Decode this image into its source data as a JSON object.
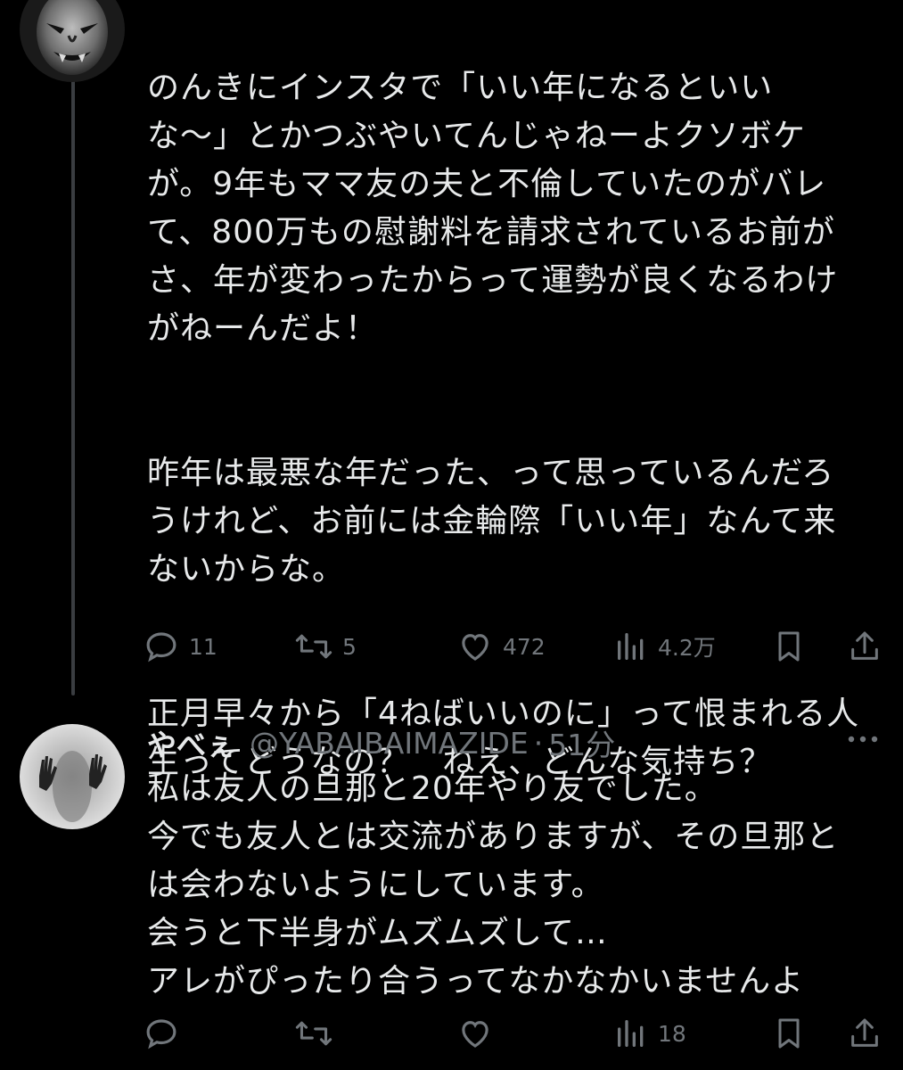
{
  "colors": {
    "background": "#000000",
    "text": "#e7e9ea",
    "muted": "#71767b",
    "thread_line": "#3a3d41"
  },
  "tweet": {
    "avatar": "oni-mask-avatar",
    "paragraphs": [
      "のんきにインスタで「いい年になるといい\nな〜」とかつぶやいてんじゃねーよクソボケ\nが。9年もママ友の夫と不倫していたのがバレ\nて、800万もの慰謝料を請求されているお前が\nさ、年が変わったからって運勢が良くなるわけ\nがねーんだよ！",
      "昨年は最悪な年だった、って思っているんだろ\nうけれど、お前には金輪際「いい年」なんて来\nないからな。",
      "正月早々から「4ねばいいのに」って恨まれる人\n生ってどうなの？　ねえ、どんな気持ち？"
    ],
    "actions": {
      "replies": "11",
      "retweets": "5",
      "likes": "472",
      "views": "4.2万"
    }
  },
  "reply": {
    "avatar": "hands-behind-glass-avatar",
    "name": "やべぇ",
    "handle": "@YABAIBAIMAZIDE",
    "separator": "·",
    "time": "51分",
    "lines": [
      "私は友人の旦那と20年やり友でした。",
      "今でも友人とは交流がありますが、その旦那と",
      "は会わないようにしています。",
      "会うと下半身がムズムズして…",
      "アレがぴったり合うってなかなかいませんよ"
    ],
    "actions": {
      "replies": "",
      "retweets": "",
      "likes": "",
      "views": "18"
    }
  }
}
